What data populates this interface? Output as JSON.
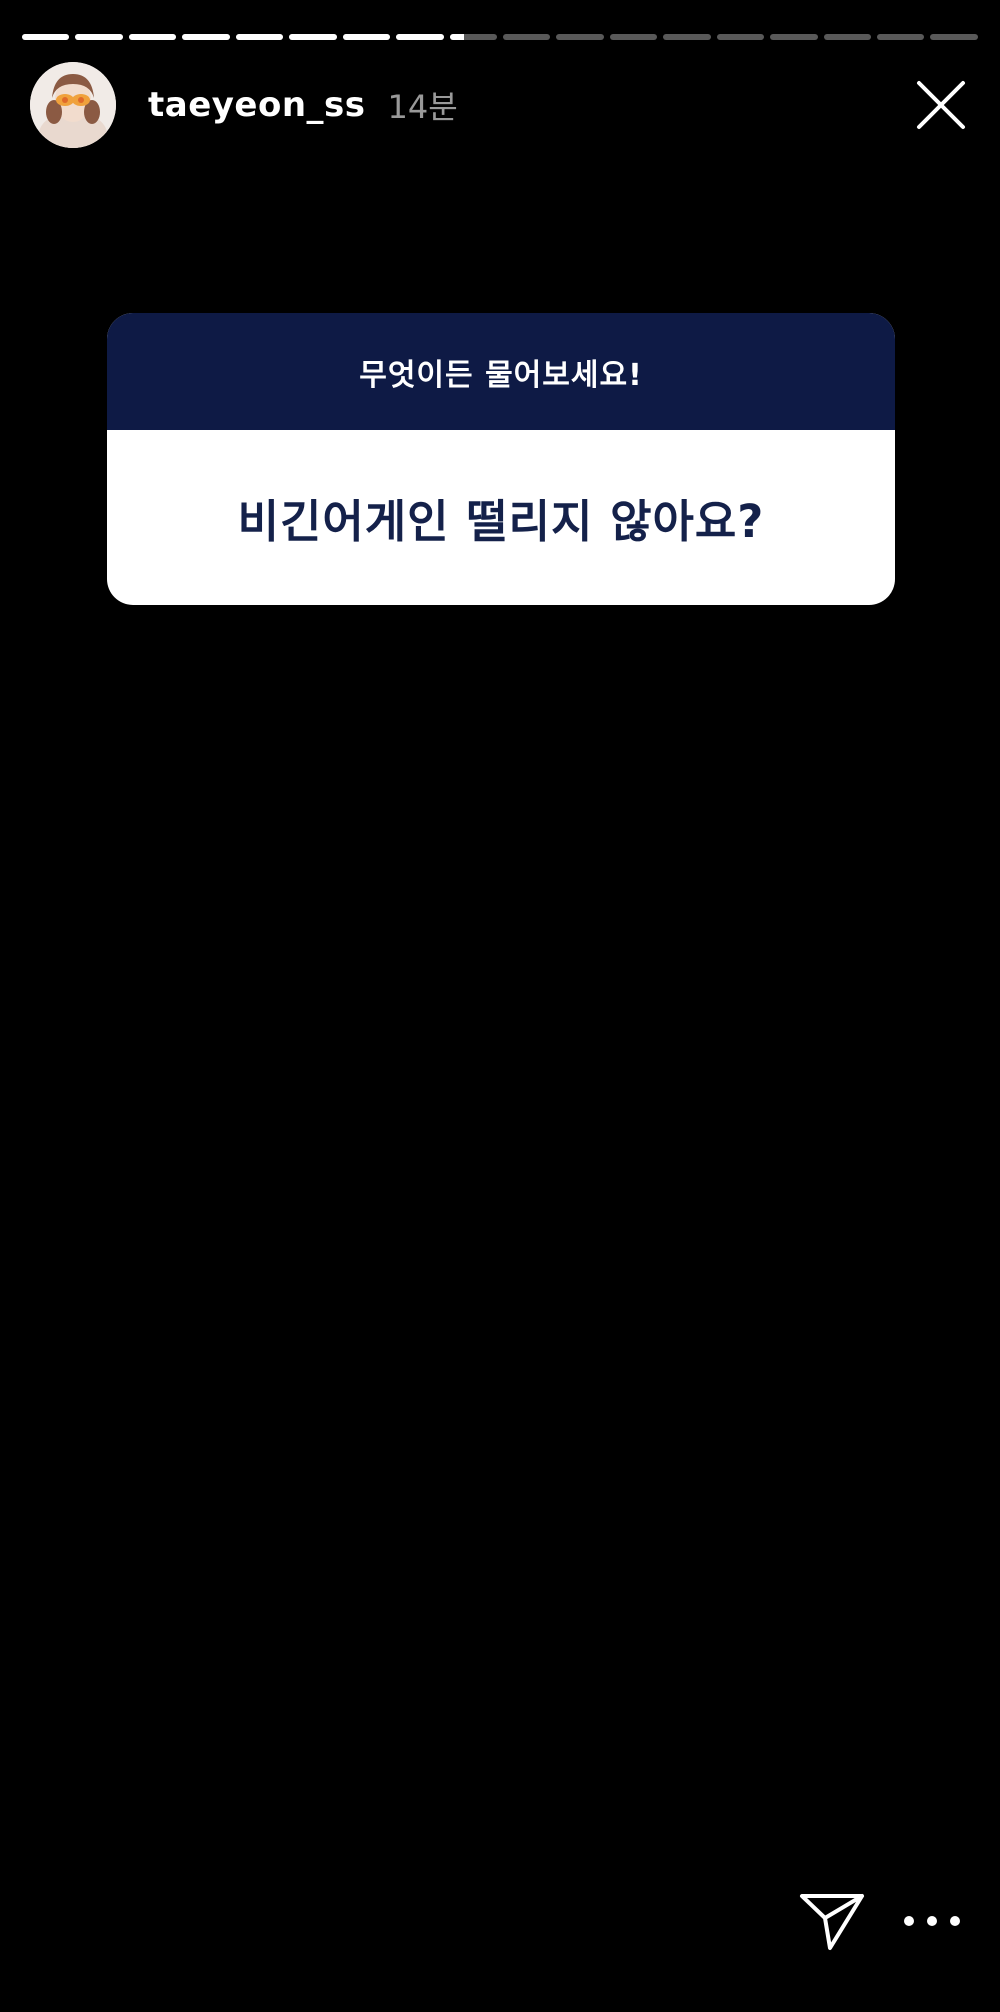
{
  "story": {
    "progress": {
      "segment_count": 18,
      "completed_segments": 8,
      "current_segment_fraction": 0.3
    }
  },
  "header": {
    "username": "taeyeon_ss",
    "timestamp": "14분",
    "avatar_icon": "profile-avatar",
    "close_icon": "close-icon"
  },
  "question_sticker": {
    "prompt": "무엇이든 물어보세요!",
    "question": "비긴어게인 떨리지 않아요?",
    "header_color": "#0e1a45",
    "question_color": "#14214a"
  },
  "footer": {
    "send_icon": "send-icon",
    "more_icon": "more-options-icon"
  }
}
